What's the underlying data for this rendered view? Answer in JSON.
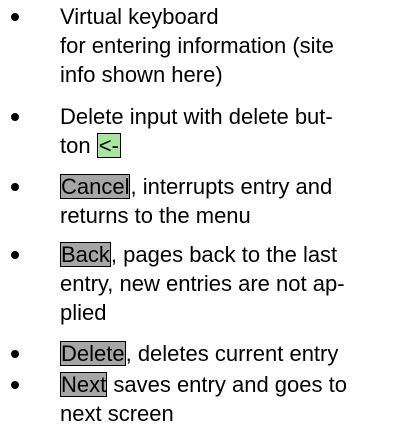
{
  "document": {
    "bullets": [
      {
        "lines": [
          "Virtual keyboard",
          "for entering information (site",
          "info shown here)"
        ]
      },
      {
        "line1": "Delete input with delete but-",
        "line2_prefix": "ton ",
        "key": "<-"
      },
      {
        "key": "Cancel",
        "line1_rest": ", interrupts entry and",
        "line2": "returns to the menu"
      },
      {
        "key": "Back",
        "line1_rest": ", pages back to the last",
        "line2": "entry, new entries are not ap-",
        "line3": "plied"
      },
      {
        "key": "Delete",
        "line1_rest": ", deletes current entry"
      },
      {
        "key": "Next",
        "line1_rest": " saves entry and goes to",
        "line2": "next screen"
      }
    ],
    "colors": {
      "key_highlight": "#a6a6a6",
      "delete_key_highlight": "#a8e6a0"
    }
  }
}
